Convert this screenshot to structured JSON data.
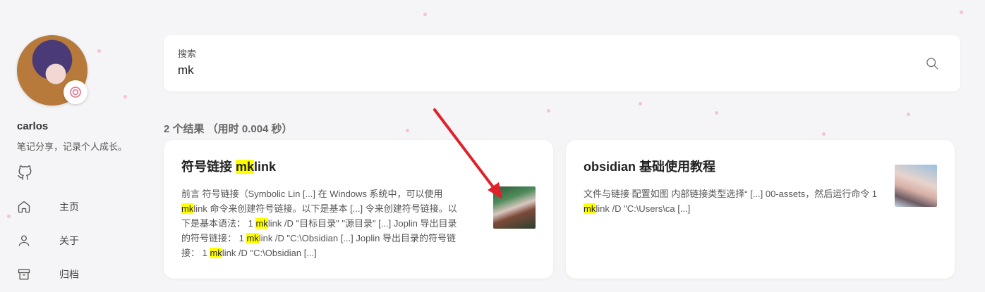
{
  "sidebar": {
    "username": "carlos",
    "bio": "笔记分享，记录个人成长。",
    "nav": [
      {
        "label": "主页",
        "icon": "home-icon"
      },
      {
        "label": "关于",
        "icon": "user-icon"
      },
      {
        "label": "归档",
        "icon": "archive-icon"
      }
    ],
    "social_icon": "github-icon"
  },
  "search": {
    "label": "搜索",
    "value": "mk"
  },
  "results": {
    "count_text": "2 个结果 （用时 0.004 秒）",
    "items": [
      {
        "title_pre": "符号链接 ",
        "title_mark": "mk",
        "title_post": "link",
        "excerpt": [
          {
            "t": "前言 符号链接（Symbolic Lin [...] 在 Windows 系统中，可以使用 "
          },
          {
            "m": "mk"
          },
          {
            "t": "link 命令来创建符号链接。以下是基本 [...] 令来创建符号链接。以下是基本语法： 1 "
          },
          {
            "m": "mk"
          },
          {
            "t": "link /D \"目标目录\" \"源目录\" [...] Joplin 导出目录的符号链接： 1 "
          },
          {
            "m": "mk"
          },
          {
            "t": "link /D \"C:\\Obsidian [...] Joplin 导出目录的符号链接： 1 "
          },
          {
            "m": "mk"
          },
          {
            "t": "link /D \"C:\\Obsidian [...]"
          }
        ]
      },
      {
        "title_pre": "obsidian 基础使用教程",
        "title_mark": "",
        "title_post": "",
        "excerpt": [
          {
            "t": "文件与链接 配置如图 内部链接类型选择“ [...] 00-assets，然后运行命令 1 "
          },
          {
            "m": "mk"
          },
          {
            "t": "link /D \"C:\\Users\\ca [...]"
          }
        ]
      }
    ]
  },
  "colors": {
    "highlight": "#ffff00",
    "arrow": "#e0202a",
    "background": "#f5f5f7"
  }
}
